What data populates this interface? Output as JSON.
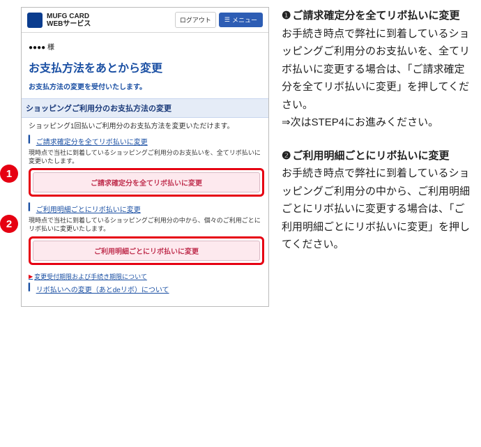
{
  "header": {
    "brand_line1": "MUFG CARD",
    "brand_line2": "WEBサービス",
    "logout": "ログアウト",
    "menu": "メニュー"
  },
  "user_name": "●●●●  様",
  "page_title": "お支払方法をあとから変更",
  "notice": "お支払方法の変更を受付いたします。",
  "section_bar": "ショッピングご利用分のお支払方法の変更",
  "section_note": "ショッピング1回払いご利用分のお支払方法を変更いただけます。",
  "link1": "ご請求確定分を全てリボ払いに変更",
  "note1": "現時点で当社に到着しているショッピングご利用分のお支払いを、全てリボ払いに変更いたします。",
  "button1": "ご請求確定分を全てリボ払いに変更",
  "link2": "ご利用明細ごとにリボ払いに変更",
  "note2": "現時点で当社に到着しているショッピングご利用分の中から、個々のご利用ごとにリボ払いに変更いたします。",
  "button2": "ご利用明細ごとにリボ払いに変更",
  "footer_link1": "変更受付期限および手続き期限について",
  "footer_link2": "リボ払いへの変更（あとdeリボ）について",
  "right": {
    "num1": "❶",
    "title1": "ご請求確定分を全てリボ払いに変更",
    "body1": "お手続き時点で弊社に到着しているショッピングご利用分のお支払いを、全てリボ払いに変更する場合は、「ご請求確定分を全てリボ払いに変更」を押してください。",
    "body1_next": "⇒次はSTEP4にお進みください。",
    "num2": "❷",
    "title2": "ご利用明細ごとにリボ払いに変更",
    "body2": "お手続き時点で弊社に到着しているショッピングご利用分の中から、ご利用明細ごとにリボ払いに変更する場合は、「ご利用明細ごとにリボ払いに変更」を押してください。"
  }
}
